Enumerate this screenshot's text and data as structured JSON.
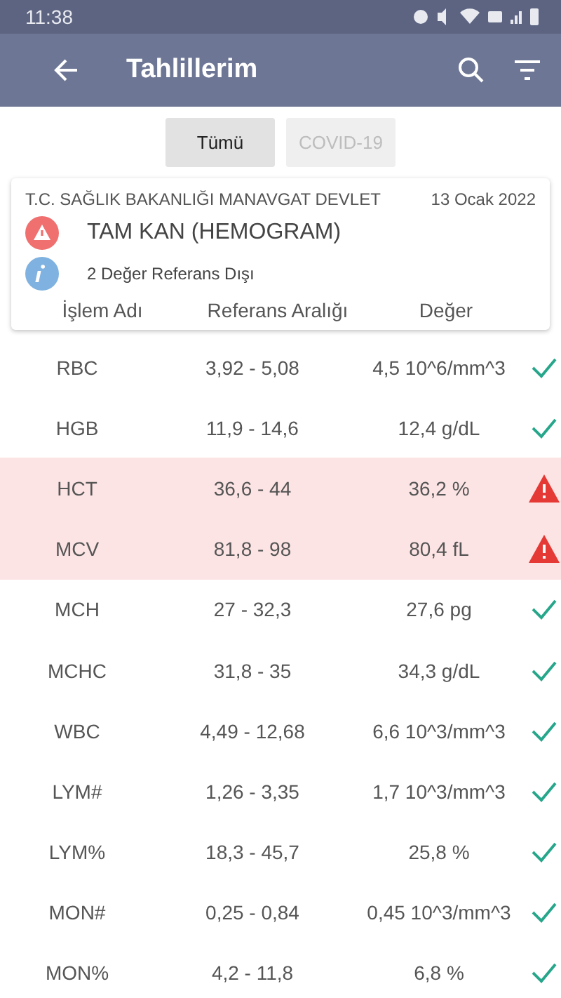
{
  "status_bar": {
    "time": "11:38"
  },
  "app_bar": {
    "title": "Tahlillerim"
  },
  "tabs": [
    {
      "label": "Tümü",
      "selected": true
    },
    {
      "label": "COVID-19",
      "selected": false
    }
  ],
  "card": {
    "hospital": "T.C. SAĞLIK BAKANLIĞI MANAVGAT DEVLET",
    "date": "13 Ocak 2022",
    "test_name": "TAM KAN (HEMOGRAM)",
    "summary": "2 Değer Referans Dışı"
  },
  "table": {
    "columns": [
      "İşlem Adı",
      "Referans Aralığı",
      "Değer"
    ],
    "rows": [
      {
        "name": "RBC",
        "range": "3,92 - 5,08",
        "value": "4,5 10^6/mm^3",
        "out_of_range": false
      },
      {
        "name": "HGB",
        "range": "11,9 - 14,6",
        "value": "12,4 g/dL",
        "out_of_range": false
      },
      {
        "name": "HCT",
        "range": "36,6 - 44",
        "value": "36,2 %",
        "out_of_range": true
      },
      {
        "name": "MCV",
        "range": "81,8 - 98",
        "value": "80,4 fL",
        "out_of_range": true
      },
      {
        "name": "MCH",
        "range": "27 - 32,3",
        "value": "27,6 pg",
        "out_of_range": false
      },
      {
        "name": "MCHC",
        "range": "31,8 - 35",
        "value": "34,3 g/dL",
        "out_of_range": false
      },
      {
        "name": "WBC",
        "range": "4,49 - 12,68",
        "value": "6,6 10^3/mm^3",
        "out_of_range": false
      },
      {
        "name": "LYM#",
        "range": "1,26 - 3,35",
        "value": "1,7 10^3/mm^3",
        "out_of_range": false
      },
      {
        "name": "LYM%",
        "range": "18,3 - 45,7",
        "value": "25,8 %",
        "out_of_range": false
      },
      {
        "name": "MON#",
        "range": "0,25 - 0,84",
        "value": "0,45 10^3/mm^3",
        "out_of_range": false
      },
      {
        "name": "MON%",
        "range": "4,2 - 11,8",
        "value": "6,8 %",
        "out_of_range": false
      }
    ]
  }
}
